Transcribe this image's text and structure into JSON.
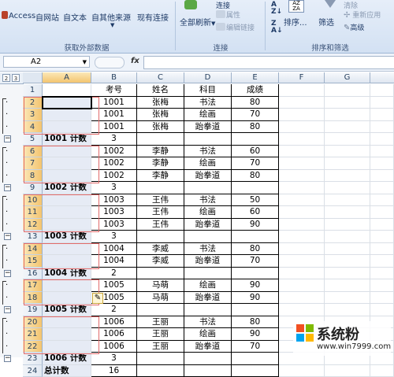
{
  "ribbon": {
    "buttons": [
      "Access",
      "自网站",
      "自文本",
      "自其他来源",
      "现有连接",
      "全部刷新"
    ],
    "small_connect": [
      "连接",
      "属性",
      "编辑链接"
    ],
    "sort": "排序...",
    "filter": "筛选",
    "small_filter": [
      "清除",
      "重新应用",
      "高级"
    ],
    "groups": [
      "获取外部数据",
      "连接",
      "排序和筛选"
    ]
  },
  "formula_bar": {
    "name_box": "A2",
    "fx": "fx",
    "formula": ""
  },
  "columns": [
    "A",
    "B",
    "C",
    "D",
    "E",
    "F",
    "G"
  ],
  "outline_levels": [
    "2",
    "3"
  ],
  "rows": [
    {
      "n": "1",
      "a": "",
      "b": "考号",
      "c": "姓名",
      "d": "科目",
      "e": "成绩",
      "type": "header"
    },
    {
      "n": "2",
      "a": "",
      "b": "1001",
      "c": "张梅",
      "d": "书法",
      "e": "80",
      "type": "detail"
    },
    {
      "n": "3",
      "a": "",
      "b": "1001",
      "c": "张梅",
      "d": "绘画",
      "e": "70",
      "type": "detail"
    },
    {
      "n": "4",
      "a": "",
      "b": "1001",
      "c": "张梅",
      "d": "跆拳道",
      "e": "80",
      "type": "detail"
    },
    {
      "n": "5",
      "a": "1001 计数",
      "b": "3",
      "c": "",
      "d": "",
      "e": "",
      "type": "subtotal"
    },
    {
      "n": "6",
      "a": "",
      "b": "1002",
      "c": "李静",
      "d": "书法",
      "e": "60",
      "type": "detail"
    },
    {
      "n": "7",
      "a": "",
      "b": "1002",
      "c": "李静",
      "d": "绘画",
      "e": "70",
      "type": "detail"
    },
    {
      "n": "8",
      "a": "",
      "b": "1002",
      "c": "李静",
      "d": "跆拳道",
      "e": "80",
      "type": "detail"
    },
    {
      "n": "9",
      "a": "1002 计数",
      "b": "3",
      "c": "",
      "d": "",
      "e": "",
      "type": "subtotal"
    },
    {
      "n": "10",
      "a": "",
      "b": "1003",
      "c": "王伟",
      "d": "书法",
      "e": "50",
      "type": "detail"
    },
    {
      "n": "11",
      "a": "",
      "b": "1003",
      "c": "王伟",
      "d": "绘画",
      "e": "60",
      "type": "detail"
    },
    {
      "n": "12",
      "a": "",
      "b": "1003",
      "c": "王伟",
      "d": "跆拳道",
      "e": "90",
      "type": "detail"
    },
    {
      "n": "13",
      "a": "1003 计数",
      "b": "3",
      "c": "",
      "d": "",
      "e": "",
      "type": "subtotal"
    },
    {
      "n": "14",
      "a": "",
      "b": "1004",
      "c": "李威",
      "d": "书法",
      "e": "80",
      "type": "detail"
    },
    {
      "n": "15",
      "a": "",
      "b": "1004",
      "c": "李威",
      "d": "跆拳道",
      "e": "70",
      "type": "detail"
    },
    {
      "n": "16",
      "a": "1004 计数",
      "b": "2",
      "c": "",
      "d": "",
      "e": "",
      "type": "subtotal"
    },
    {
      "n": "17",
      "a": "",
      "b": "1005",
      "c": "马萌",
      "d": "绘画",
      "e": "90",
      "type": "detail"
    },
    {
      "n": "18",
      "a": "",
      "b": "1005",
      "c": "马萌",
      "d": "跆拳道",
      "e": "90",
      "type": "detail"
    },
    {
      "n": "19",
      "a": "1005 计数",
      "b": "2",
      "c": "",
      "d": "",
      "e": "",
      "type": "subtotal"
    },
    {
      "n": "20",
      "a": "",
      "b": "1006",
      "c": "王丽",
      "d": "书法",
      "e": "80",
      "type": "detail"
    },
    {
      "n": "21",
      "a": "",
      "b": "1006",
      "c": "王丽",
      "d": "绘画",
      "e": "90",
      "type": "detail"
    },
    {
      "n": "22",
      "a": "",
      "b": "1006",
      "c": "王丽",
      "d": "跆拳道",
      "e": "70",
      "type": "detail"
    },
    {
      "n": "23",
      "a": "1006 计数",
      "b": "3",
      "c": "",
      "d": "",
      "e": "",
      "type": "subtotal"
    },
    {
      "n": "24",
      "a": "总计数",
      "b": "16",
      "c": "",
      "d": "",
      "e": "",
      "type": "total"
    }
  ],
  "watermark": {
    "name": "系统粉",
    "url": "www.win7999.com",
    "colors": [
      "#f25022",
      "#7fba00",
      "#00a4ef",
      "#ffb900"
    ]
  }
}
